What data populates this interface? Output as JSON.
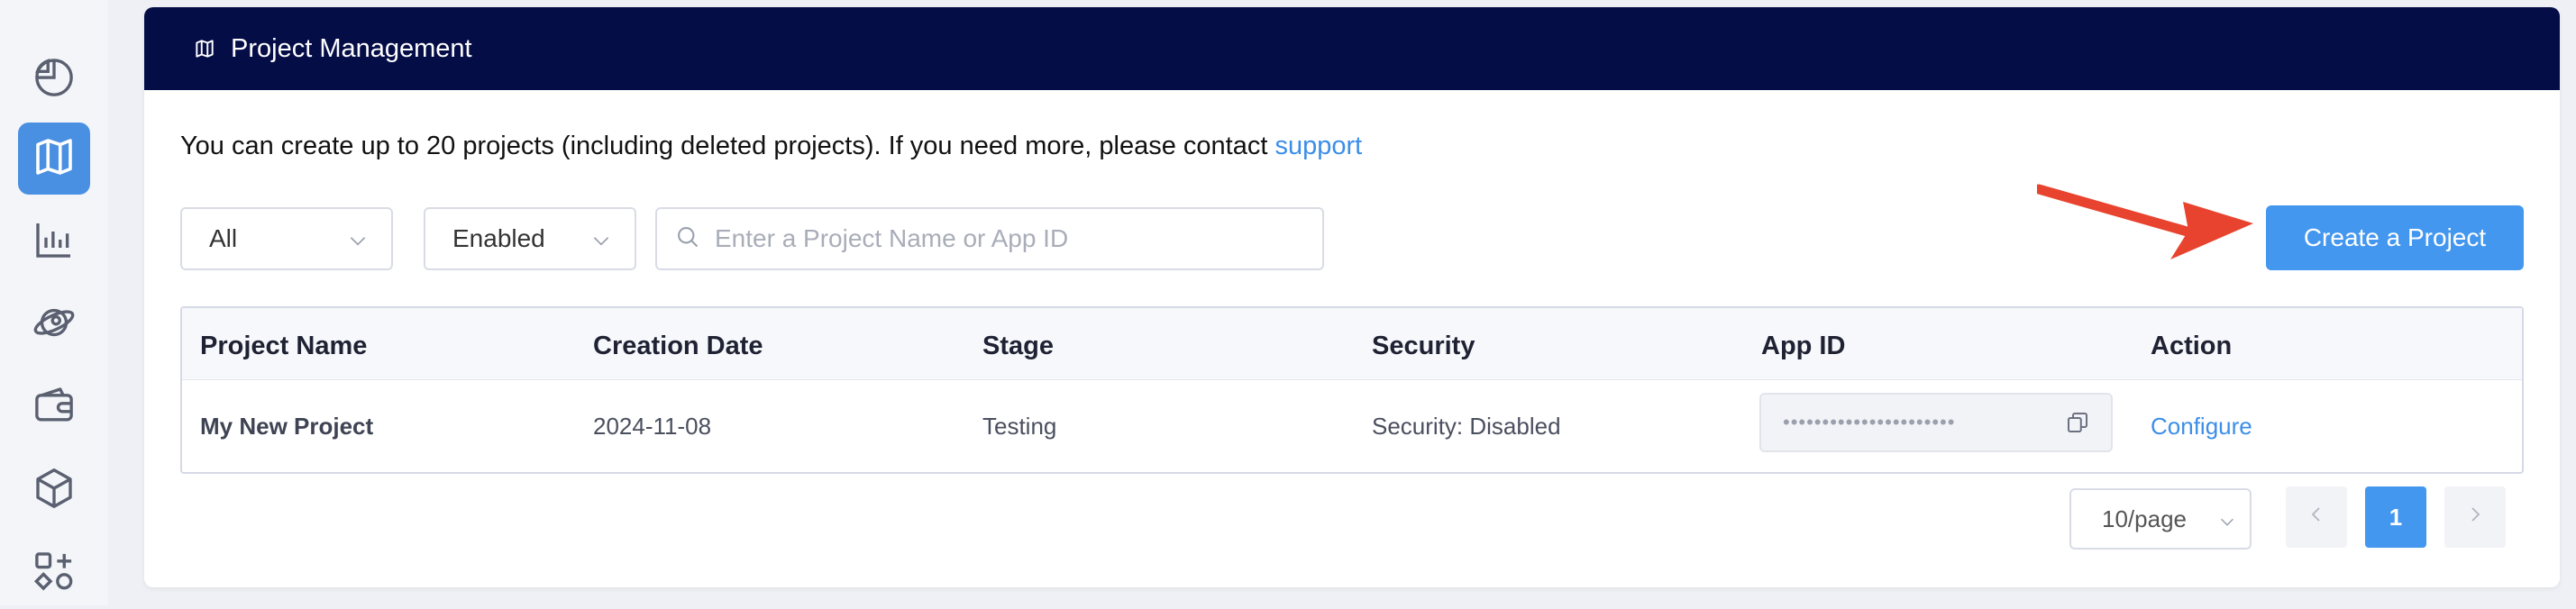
{
  "sidebar": {
    "items": [
      {
        "icon": "pie-chart-icon",
        "active": false
      },
      {
        "icon": "map-icon",
        "active": true
      },
      {
        "icon": "bar-chart-icon",
        "active": false
      },
      {
        "icon": "planet-icon",
        "active": false
      },
      {
        "icon": "wallet-icon",
        "active": false
      },
      {
        "icon": "cube-icon",
        "active": false
      },
      {
        "icon": "apps-icon",
        "active": false
      }
    ]
  },
  "header": {
    "title": "Project Management",
    "icon": "map-icon"
  },
  "notice": {
    "text": "You can create up to 20 projects (including deleted projects). If you need more, please contact ",
    "link": "support"
  },
  "filters": {
    "type_value": "All",
    "status_value": "Enabled",
    "search_placeholder": "Enter a Project Name or App ID",
    "search_value": ""
  },
  "create_button": "Create a Project",
  "table": {
    "columns": [
      "Project Name",
      "Creation Date",
      "Stage",
      "Security",
      "App ID",
      "Action"
    ],
    "rows": [
      {
        "name": "My New Project",
        "date": "2024-11-08",
        "stage": "Testing",
        "security": "Security: Disabled",
        "app_id_masked": "••••••••••••••••••••••",
        "action": "Configure"
      }
    ]
  },
  "pagination": {
    "page_size": "10/page",
    "current_page": "1"
  },
  "colors": {
    "header_bg": "#050d47",
    "accent": "#4497ef",
    "link": "#3c8ee8",
    "annotation_arrow": "#e8432e"
  }
}
